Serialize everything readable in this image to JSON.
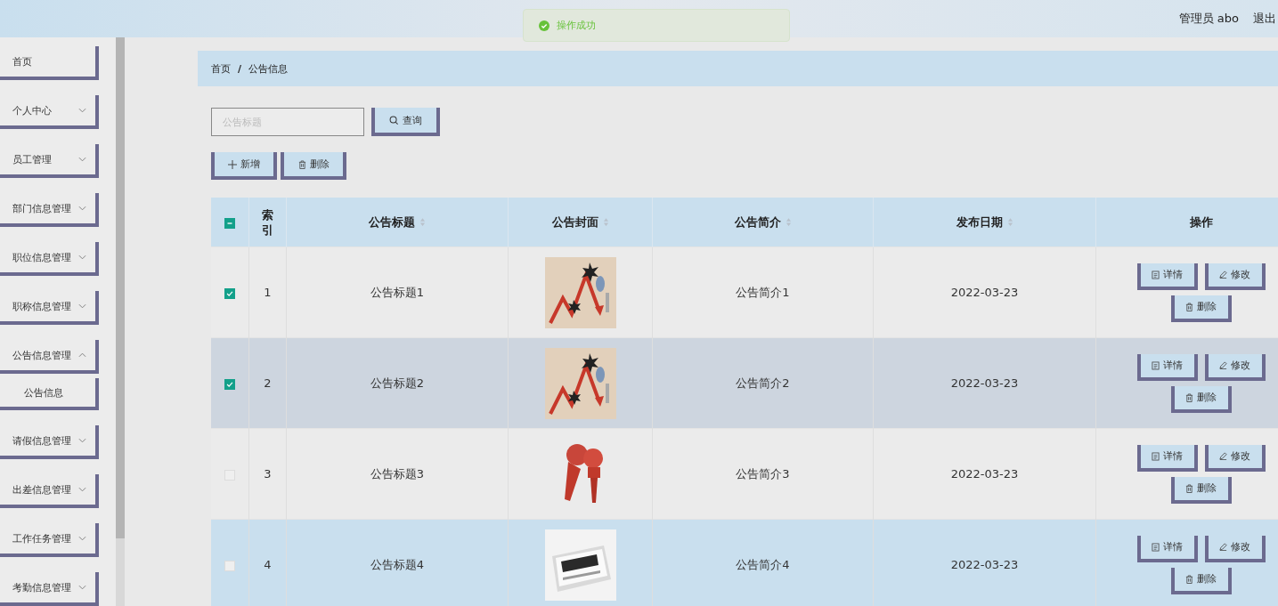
{
  "header": {
    "user": "管理员 abo",
    "logout": "退出"
  },
  "toast": {
    "message": "操作成功"
  },
  "sidebar": {
    "items": [
      {
        "label": "首页"
      },
      {
        "label": "个人中心",
        "expanded": false
      },
      {
        "label": "员工管理",
        "expanded": false
      },
      {
        "label": "部门信息管理",
        "expanded": false
      },
      {
        "label": "职位信息管理",
        "expanded": false
      },
      {
        "label": "职称信息管理",
        "expanded": false
      },
      {
        "label": "公告信息管理",
        "expanded": true,
        "children": [
          {
            "label": "公告信息"
          }
        ]
      },
      {
        "label": "请假信息管理",
        "expanded": false
      },
      {
        "label": "出差信息管理",
        "expanded": false
      },
      {
        "label": "工作任务管理",
        "expanded": false
      },
      {
        "label": "考勤信息管理",
        "expanded": false
      }
    ]
  },
  "breadcrumb": {
    "items": [
      "首页",
      "公告信息"
    ],
    "separator": "/"
  },
  "search": {
    "placeholder": "公告标题",
    "button": "查询"
  },
  "toolbar": {
    "add": "新增",
    "delete": "删除"
  },
  "table": {
    "select_all": {
      "indeterminate": true
    },
    "columns": [
      {
        "label": "索引",
        "sortable": false
      },
      {
        "label": "公告标题",
        "sortable": true
      },
      {
        "label": "公告封面",
        "sortable": true
      },
      {
        "label": "公告简介",
        "sortable": true
      },
      {
        "label": "发布日期",
        "sortable": true
      },
      {
        "label": "操作",
        "sortable": false
      }
    ],
    "rows": [
      {
        "index": "1",
        "title": "公告标题1",
        "summary": "公告简介1",
        "date": "2022-03-23",
        "checked": true,
        "hovered": false,
        "highlighted": false,
        "actions": {
          "detail": "详情",
          "edit": "修改",
          "delete": "删除"
        }
      },
      {
        "index": "2",
        "title": "公告标题2",
        "summary": "公告简介2",
        "date": "2022-03-23",
        "checked": true,
        "hovered": true,
        "highlighted": false,
        "actions": {
          "detail": "详情",
          "edit": "修改",
          "delete": "删除"
        }
      },
      {
        "index": "3",
        "title": "公告标题3",
        "summary": "公告简介3",
        "date": "2022-03-23",
        "checked": false,
        "hovered": false,
        "highlighted": false,
        "actions": {
          "detail": "详情",
          "edit": "修改",
          "delete": "删除"
        }
      },
      {
        "index": "4",
        "title": "公告标题4",
        "summary": "公告简介4",
        "date": "2022-03-23",
        "checked": false,
        "hovered": false,
        "highlighted": true,
        "actions": {
          "detail": "详情",
          "edit": "修改",
          "delete": "删除"
        }
      }
    ]
  }
}
